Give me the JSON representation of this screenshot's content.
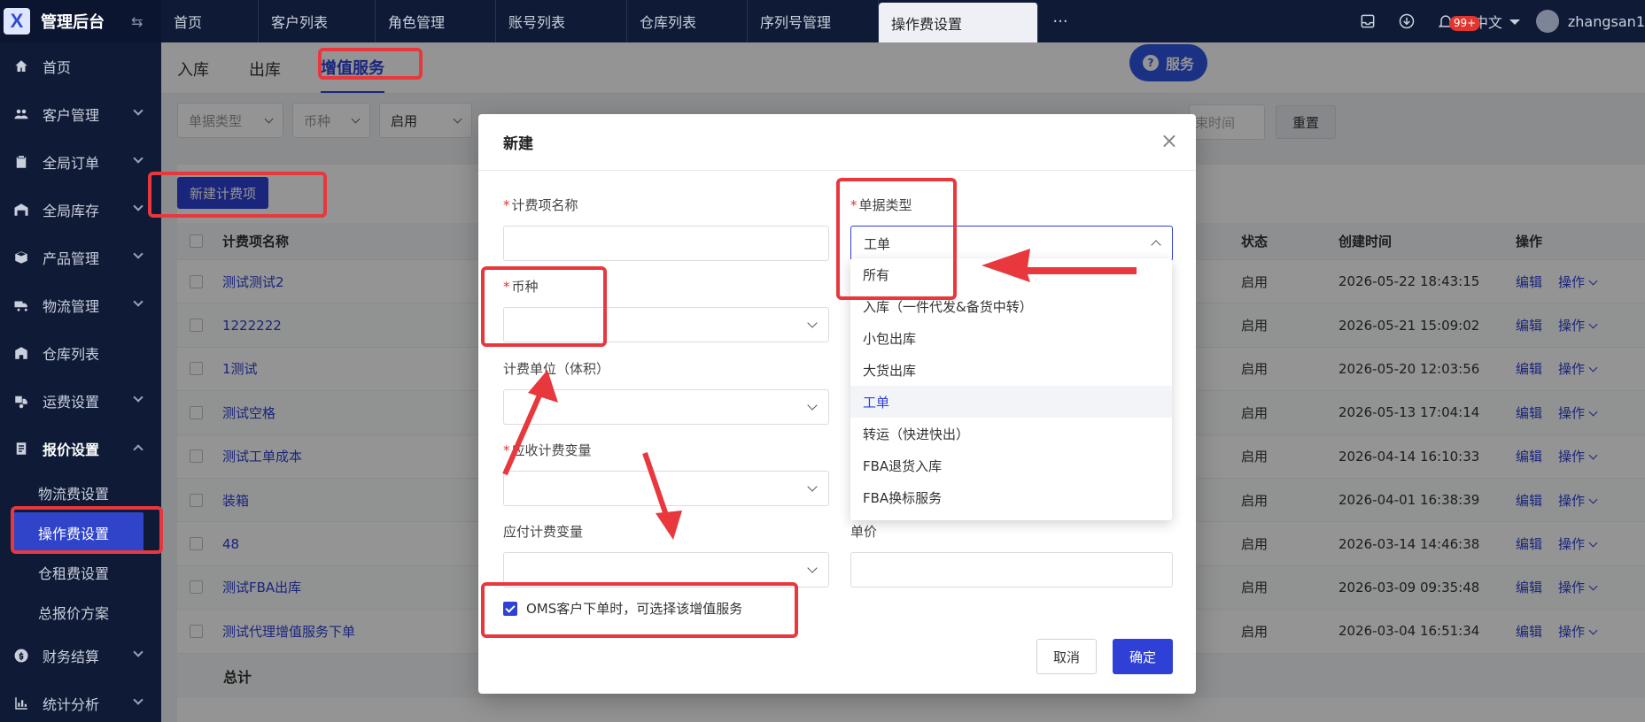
{
  "app": {
    "title": "管理后台",
    "logo_letter": "X"
  },
  "sidebar": {
    "items": [
      {
        "label": "首页",
        "icon": "home-icon",
        "has_sub": false
      },
      {
        "label": "客户管理",
        "icon": "users-icon",
        "has_sub": true
      },
      {
        "label": "全局订单",
        "icon": "clipboard-icon",
        "has_sub": true
      },
      {
        "label": "全局库存",
        "icon": "warehouse-icon",
        "has_sub": true
      },
      {
        "label": "产品管理",
        "icon": "box-icon",
        "has_sub": true
      },
      {
        "label": "物流管理",
        "icon": "truck-icon",
        "has_sub": true
      },
      {
        "label": "仓库列表",
        "icon": "building-icon",
        "has_sub": false
      },
      {
        "label": "运费设置",
        "icon": "freight-icon",
        "has_sub": true
      },
      {
        "label": "报价设置",
        "icon": "quote-icon",
        "has_sub": true,
        "open": true
      },
      {
        "label": "财务结算",
        "icon": "finance-icon",
        "has_sub": true
      },
      {
        "label": "统计分析",
        "icon": "chart-icon",
        "has_sub": true
      }
    ],
    "sub_items": [
      "物流费设置",
      "操作费设置",
      "仓租费设置",
      "总报价方案"
    ],
    "active_sub": "操作费设置"
  },
  "topbar": {
    "tabs": [
      "首页",
      "客户列表",
      "角色管理",
      "账号列表",
      "仓库列表",
      "序列号管理",
      "操作费设置"
    ],
    "active_tab": "操作费设置",
    "badge": "99+",
    "lang": "中文",
    "user": "zhangsan1"
  },
  "subtabs": [
    "入库",
    "出库",
    "增值服务"
  ],
  "active_subtab": "增值服务",
  "service_button": "服务",
  "filters": [
    {
      "placeholder": "单据类型"
    },
    {
      "placeholder": "币种"
    },
    {
      "value": "启用"
    }
  ],
  "date_tail": "束时间",
  "reset_label": "重置",
  "new_fee_label": "新建计费项",
  "table": {
    "headers": {
      "name": "计费项名称",
      "state": "状态",
      "time": "创建时间",
      "op": "操作"
    },
    "rows": [
      {
        "name": "测试测试2",
        "state": "启用",
        "time": "2026-05-22 18:43:15"
      },
      {
        "name": "1222222",
        "state": "启用",
        "time": "2026-05-21 15:09:02"
      },
      {
        "name": "1测试",
        "state": "启用",
        "time": "2026-05-20 12:03:56"
      },
      {
        "name": "测试空格",
        "state": "启用",
        "time": "2026-05-13 17:04:14"
      },
      {
        "name": "测试工单成本",
        "state": "启用",
        "time": "2026-04-14 16:10:33"
      },
      {
        "name": "装箱",
        "state": "启用",
        "time": "2026-04-01 16:38:39"
      },
      {
        "name": "48",
        "state": "启用",
        "time": "2026-03-14 14:46:38"
      },
      {
        "name": "测试FBA出库",
        "state": "启用",
        "time": "2026-03-09 09:35:48"
      },
      {
        "name": "测试代理增值服务下单",
        "state": "启用",
        "time": "2026-03-04 16:51:34"
      }
    ],
    "op_edit": "编辑",
    "op_more": "操作",
    "total_label": "总计"
  },
  "modal": {
    "title": "新建",
    "close": "×",
    "fields": {
      "fee_name": {
        "label": "计费项名称",
        "required": true,
        "value": ""
      },
      "doc_type": {
        "label": "单据类型",
        "required": true,
        "value": "工单"
      },
      "currency": {
        "label": "币种",
        "required": true,
        "value": ""
      },
      "unit": {
        "label": "计费单位（体积）",
        "required": false,
        "value": ""
      },
      "receivable_var": {
        "label": "应收计费变量",
        "required": true,
        "value": ""
      },
      "payable_var": {
        "label": "应付计费变量",
        "required": false,
        "value": ""
      },
      "unit_price": {
        "label": "单价",
        "required": false,
        "value": ""
      }
    },
    "required_mark": "*",
    "oms_checkbox": {
      "label": "OMS客户下单时，可选择该增值服务",
      "checked": true
    },
    "cancel_label": "取消",
    "ok_label": "确定"
  },
  "doc_type_options": [
    "所有",
    "入库（一件代发&备货中转）",
    "小包出库",
    "大货出库",
    "工单",
    "转运（快进快出）",
    "FBA退货入库",
    "FBA换标服务"
  ],
  "doc_type_selected": "工单",
  "colors": {
    "primary": "#2e40d6",
    "sidebar_bg": "#0f1b36",
    "annotation": "#e8383d"
  }
}
